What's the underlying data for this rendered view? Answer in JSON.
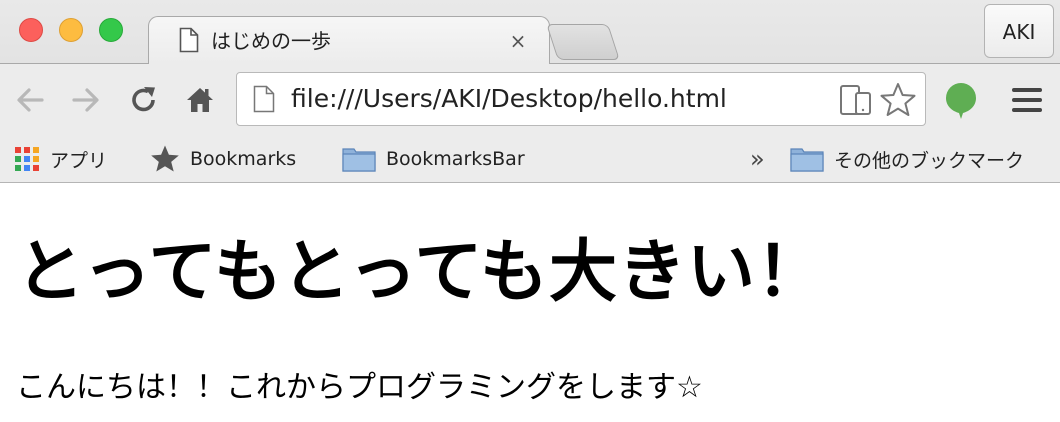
{
  "window": {
    "tab_title": "はじめの一歩",
    "tab_close": "×",
    "profile_name": "AKI"
  },
  "toolbar": {
    "url": "file:///Users/AKI/Desktop/hello.html"
  },
  "bookmarks": {
    "items": [
      {
        "label": "アプリ",
        "icon": "apps-grid-icon"
      },
      {
        "label": "Bookmarks",
        "icon": "star-icon"
      },
      {
        "label": "BookmarksBar",
        "icon": "folder-icon"
      }
    ],
    "overflow": "»",
    "other": {
      "label": "その他のブックマーク",
      "icon": "folder-icon"
    }
  },
  "page": {
    "heading": "とってもとっても大きい！",
    "paragraph": "こんにちは！！これからプログラミングをします☆"
  }
}
